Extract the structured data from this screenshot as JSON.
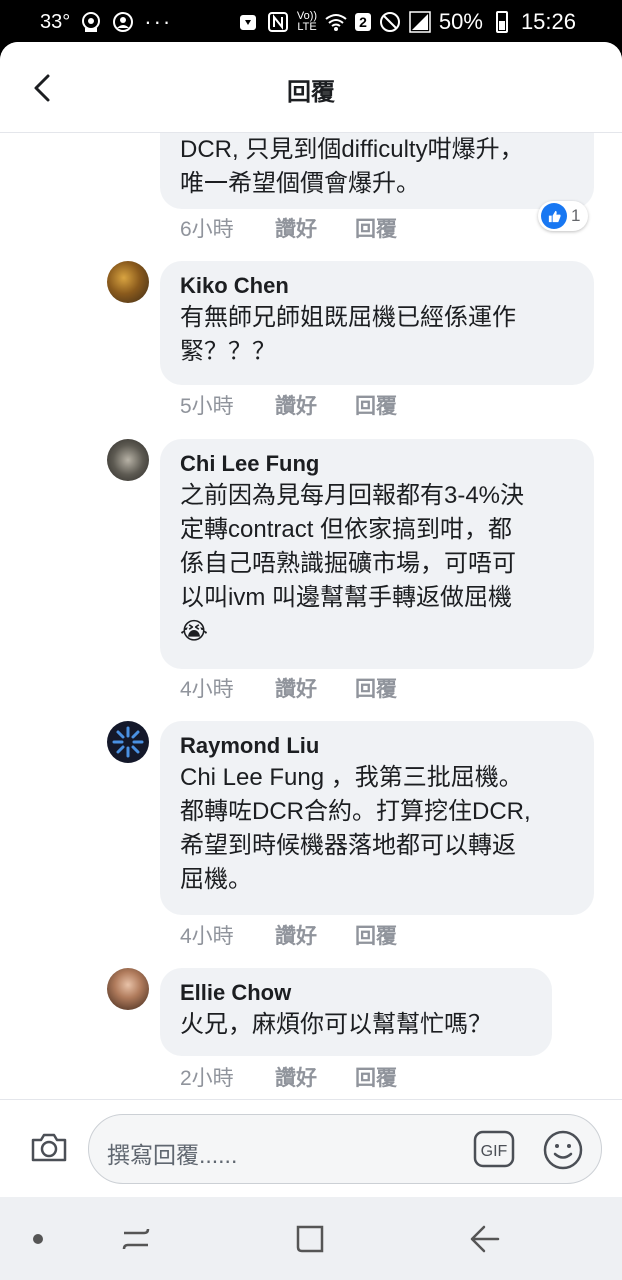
{
  "status": {
    "temperature": "33°",
    "signal_type": "LTE",
    "sim_badge": "2",
    "battery": "50%",
    "time": "15:26"
  },
  "header": {
    "title": "回覆"
  },
  "comments": [
    {
      "author": "",
      "text": "DCR, 只見到個difficulty咁爆升，\n唯一希望個價會爆升。",
      "time": "6小時",
      "like_label": "讚好",
      "reply_label": "回覆",
      "reaction_count": "1"
    },
    {
      "author": "Kiko Chen",
      "text": "有無師兄師姐既屈機已經係運作\n緊？？？",
      "time": "5小時",
      "like_label": "讚好",
      "reply_label": "回覆"
    },
    {
      "author": "Chi Lee Fung",
      "text": "之前因為見每月回報都有3-4%決\n定轉contract 但依家搞到咁，都\n係自己唔熟識掘礦市場，可唔可\n以叫ivm 叫邊幫幫手轉返做屈機",
      "emoji": "😭",
      "time": "4小時",
      "like_label": "讚好",
      "reply_label": "回覆"
    },
    {
      "author": "Raymond Liu",
      "text": "Chi Lee Fung ，我第三批屈機。\n都轉咗DCR合約。打算挖住DCR,\n希望到時候機器落地都可以轉返\n屈機。",
      "time": "4小時",
      "like_label": "讚好",
      "reply_label": "回覆"
    },
    {
      "author": "Ellie Chow",
      "text": "火兄，麻煩你可以幫幫忙嗎？",
      "time": "2小時",
      "like_label": "讚好",
      "reply_label": "回覆"
    }
  ],
  "composer": {
    "placeholder": "撰寫回覆......",
    "gif_label": "GIF"
  },
  "colors": {
    "accent": "#1877f2",
    "bubble": "#f0f2f5",
    "meta": "#90949c"
  }
}
